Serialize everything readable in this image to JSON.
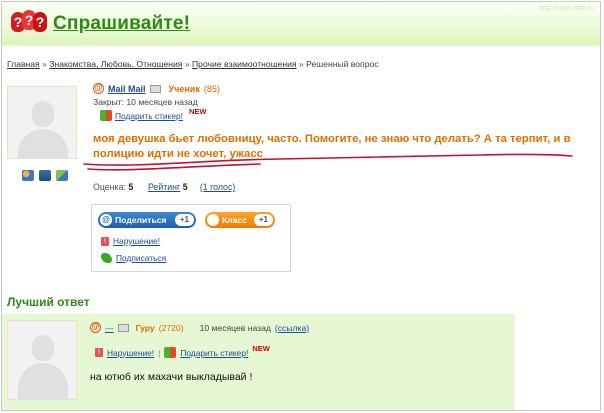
{
  "header": {
    "logo_glyph": "?",
    "title": "Спрашивайте!",
    "watermark": "http://otvet.mail.ru"
  },
  "breadcrumb": {
    "items": [
      "Главная",
      "Знакомства, Любовь, Отношения",
      "Прочие взаимоотношения"
    ],
    "separator": "»",
    "current": "Решенный вопрос"
  },
  "question": {
    "author": {
      "at_symbol": "@",
      "name": "Mail Mail",
      "rank": "Ученик",
      "points": "(85)"
    },
    "closed": "Закрыт: 10 месяцев назад",
    "sticker_label": "Подарить стикер!",
    "new_badge": "NEW",
    "text": "моя девушка бьет любовницу, часто. Помогите, не знаю что делать? А та терпит, и в полицию идти не хочет, ужасс",
    "rating_label": "Оценка:",
    "rating_value": "5",
    "ranking_label": "Рейтинг",
    "ranking_value": "5",
    "votes": "(1 голос)",
    "icons": [
      "users-icon",
      "camera-icon",
      "video-icon"
    ],
    "underline_color": "#c8102e"
  },
  "share": {
    "share_label": "Поделиться",
    "share_count": "+1",
    "klass_label": "Класс",
    "klass_count": "+1",
    "violation": "Нарушение!",
    "subscribe": "Подписаться"
  },
  "best_answer": {
    "section_title": "Лучший ответ",
    "author": {
      "at_symbol": "@",
      "name": "---",
      "rank": "Гуру",
      "points": "(2720)",
      "when": "10 месяцев назад",
      "link": "(ссылка)"
    },
    "violation": "Нарушение!",
    "sticker_label": "Подарить стикер!",
    "new_badge": "NEW",
    "text": "на ютюб их махачи выкладывай !"
  },
  "colors": {
    "brand_green": "#2f8a14",
    "accent_orange": "#e07000",
    "link_blue": "#1a4e9a",
    "answer_bg": "#e6f7d4"
  }
}
